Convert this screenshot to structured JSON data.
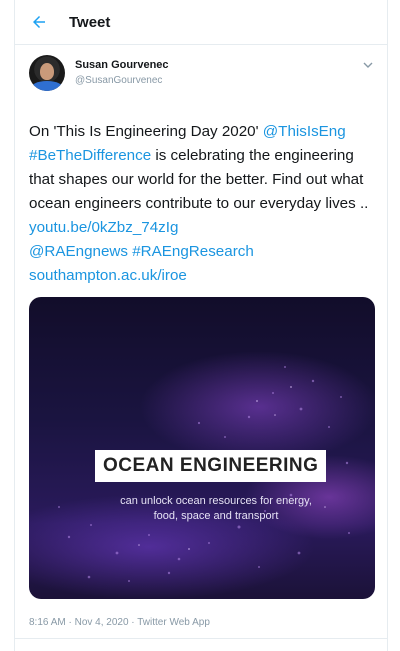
{
  "header": {
    "title": "Tweet"
  },
  "author": {
    "display_name": "Susan Gourvenec",
    "handle": "@SusanGourvenec"
  },
  "tweet": {
    "text_1": "On 'This Is Engineering Day 2020' ",
    "mention_thisiseng": "@ThisIsEng",
    "hashtag_bethedifference": "#BeTheDifference",
    "text_2": " is celebrating the engineering that shapes our world for the better. Find out what ocean engineers contribute to our everyday lives ..",
    "link_youtube": "youtu.be/0kZbz_74zIg",
    "mention_raengnews": "@RAEngnews",
    "hashtag_raengresearch": "#RAEngResearch",
    "link_southampton": "southampton.ac.uk/iroe"
  },
  "media": {
    "title": "OCEAN ENGINEERING",
    "subtitle_line_1": "can unlock ocean resources for energy,",
    "subtitle_line_2": "food, space and transport"
  },
  "meta": {
    "time": "8:16 AM",
    "date": "Nov 4, 2020",
    "source": "Twitter Web App",
    "separator": " · "
  },
  "colors": {
    "link": "#1b95e0",
    "accent": "#1da1f2",
    "secondary_text": "#8899a6"
  },
  "icons": {
    "back": "back-arrow-icon",
    "more": "chevron-down-icon"
  }
}
